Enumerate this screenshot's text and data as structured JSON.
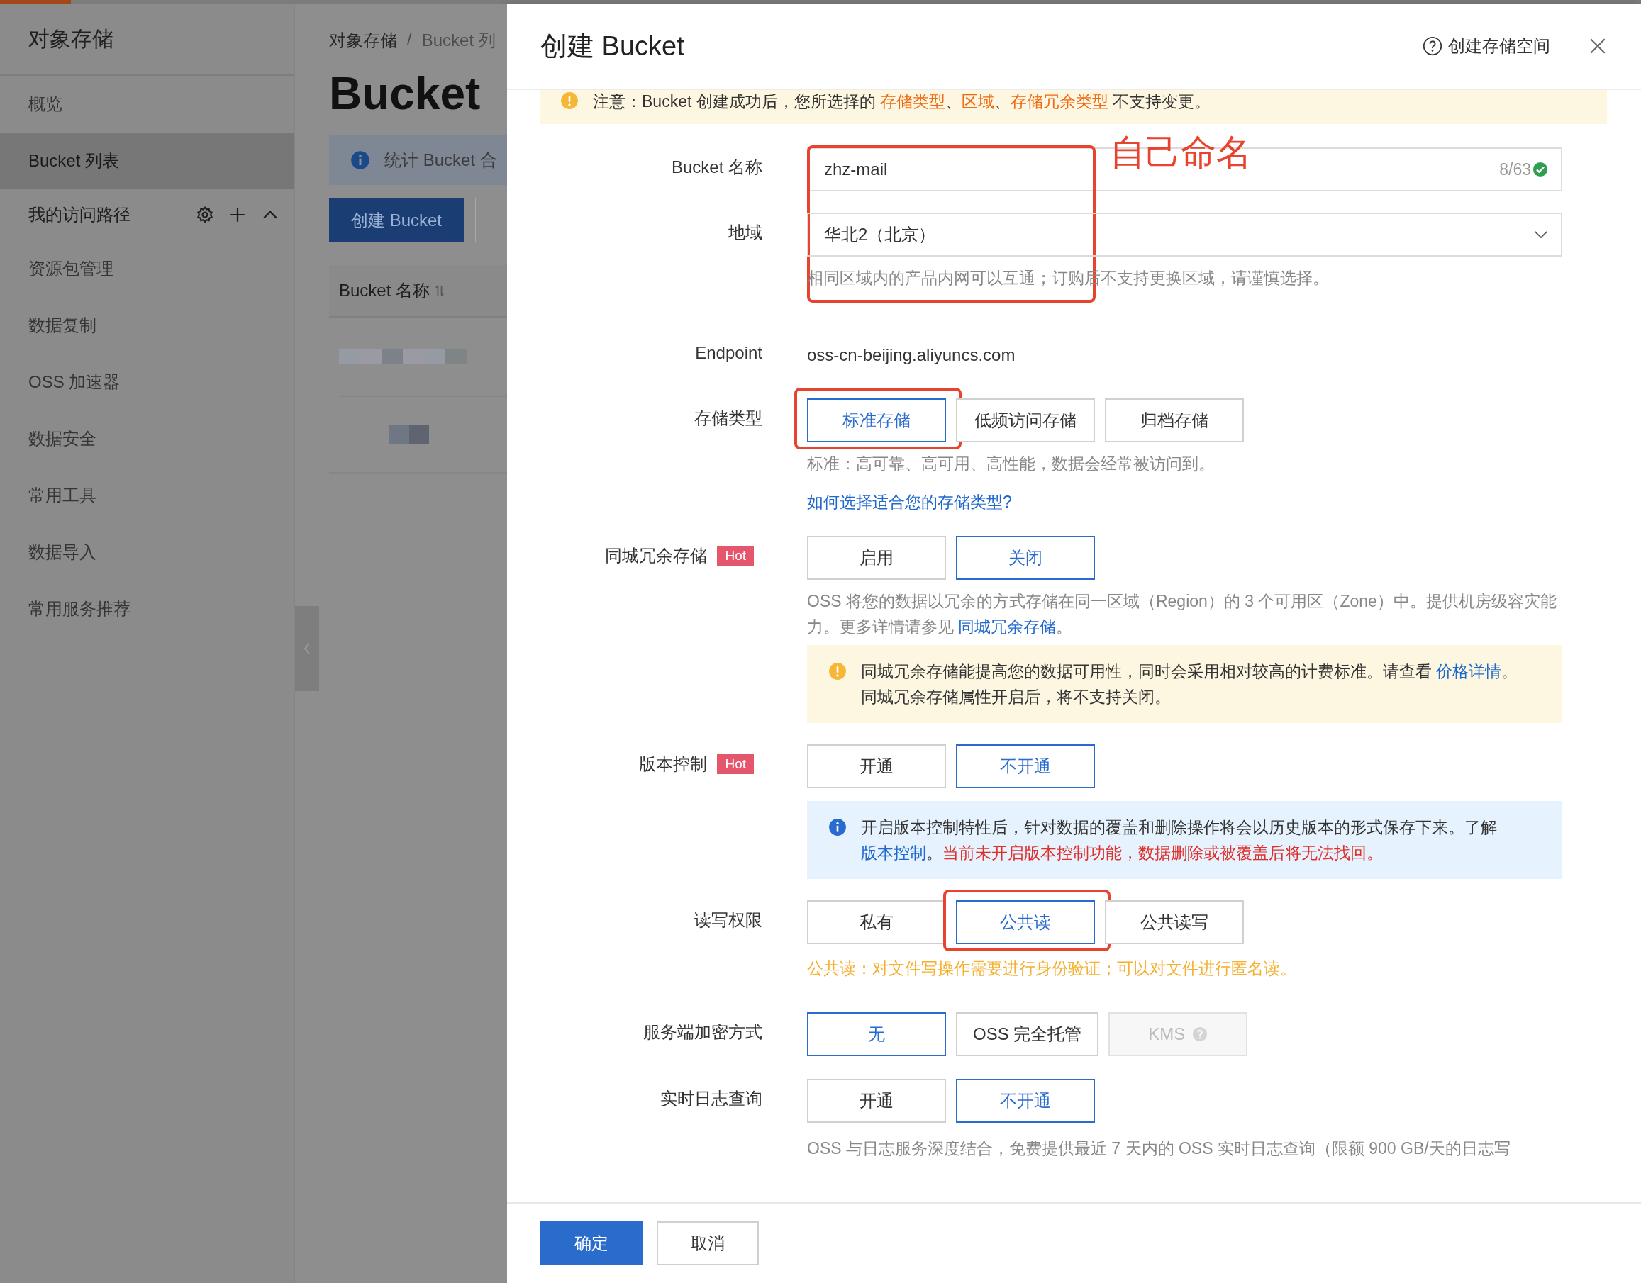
{
  "sidebar": {
    "title": "对象存储",
    "items": [
      {
        "label": "概览",
        "kind": "link",
        "selected": false
      },
      {
        "label": "Bucket 列表",
        "kind": "link",
        "selected": true
      },
      {
        "label": "我的访问路径",
        "kind": "group",
        "expanded": true
      },
      {
        "label": "资源包管理",
        "kind": "link",
        "selected": false
      },
      {
        "label": "数据复制",
        "kind": "link",
        "selected": false
      },
      {
        "label": "OSS 加速器",
        "kind": "link",
        "selected": false
      },
      {
        "label": "数据安全",
        "kind": "link",
        "selected": false
      },
      {
        "label": "常用工具",
        "kind": "link",
        "selected": false
      },
      {
        "label": "数据导入",
        "kind": "link",
        "selected": false
      },
      {
        "label": "常用服务推荐",
        "kind": "link",
        "selected": false
      }
    ]
  },
  "background_page": {
    "breadcrumb": [
      "对象存储",
      "Bucket 列"
    ],
    "breadcrumb_separator": "/",
    "heading": "Bucket",
    "info": "统计 Bucket 合",
    "primary_button": "创建 Bucket",
    "table": {
      "columns": [
        "Bucket 名称"
      ]
    }
  },
  "dialog": {
    "title": "创建 Bucket",
    "help": "创建存储空间",
    "notice": [
      {
        "kind": "plain",
        "text": "注意：Bucket 创建成功后，您所选择的 "
      },
      {
        "kind": "accent",
        "text": "存储类型"
      },
      {
        "kind": "plain",
        "text": "、"
      },
      {
        "kind": "accent",
        "text": "区域"
      },
      {
        "kind": "plain",
        "text": "、"
      },
      {
        "kind": "accent",
        "text": "存储冗余类型"
      },
      {
        "kind": "plain",
        "text": " 不支持变更。"
      }
    ],
    "annotation": {
      "text": "自己命名"
    },
    "fields": [
      {
        "kind": "input",
        "label": "Bucket 名称",
        "value": "zhz-mail",
        "counter": "8/63",
        "valid": true,
        "highlighted": true
      },
      {
        "kind": "select",
        "label": "地域",
        "value": "华北2（北京）",
        "hint": "相同区域内的产品内网可以互通；订购后不支持更换区域，请谨慎选择。",
        "highlighted": true
      },
      {
        "kind": "text",
        "label": "Endpoint",
        "value": "oss-cn-beijing.aliyuncs.com"
      },
      {
        "kind": "options",
        "label": "存储类型",
        "options": [
          {
            "label": "标准存储",
            "selected": true,
            "highlighted": true,
            "disabled": false
          },
          {
            "label": "低频访问存储",
            "selected": false,
            "highlighted": false,
            "disabled": false
          },
          {
            "label": "归档存储",
            "selected": false,
            "highlighted": false,
            "disabled": false
          }
        ],
        "hint": "标准：高可靠、高可用、高性能，数据会经常被访问到。",
        "hint_warning": false,
        "link": "如何选择适合您的存储类型?"
      },
      {
        "kind": "options",
        "label": "同城冗余存储",
        "badge": "Hot",
        "options": [
          {
            "label": "启用",
            "selected": false,
            "highlighted": false,
            "disabled": false
          },
          {
            "label": "关闭",
            "selected": true,
            "highlighted": false,
            "disabled": false
          }
        ],
        "description": [
          {
            "kind": "plain",
            "text": "OSS 将您的数据以冗余的方式存储在同一区域（Region）的 3 个可用区（Zone）中。提供机房级容灾能力。更多详情请参见 "
          },
          {
            "kind": "link",
            "text": "同城冗余存储"
          },
          {
            "kind": "plain",
            "text": "。"
          }
        ],
        "alert": {
          "kind": "warning",
          "segments": [
            {
              "kind": "plain",
              "text": "同城冗余存储能提高您的数据可用性，同时会采用相对较高的计费标准。请查看 "
            },
            {
              "kind": "link",
              "text": "价格详情"
            },
            {
              "kind": "plain",
              "text": "。同城冗余存储属性开启后，将不支持关闭。"
            }
          ]
        }
      },
      {
        "kind": "options",
        "label": "版本控制",
        "badge": "Hot",
        "options": [
          {
            "label": "开通",
            "selected": false,
            "highlighted": false,
            "disabled": false
          },
          {
            "label": "不开通",
            "selected": true,
            "highlighted": false,
            "disabled": false
          }
        ],
        "alert": {
          "kind": "info",
          "segments": [
            {
              "kind": "plain",
              "text": "开启版本控制特性后，针对数据的覆盖和删除操作将会以历史版本的形式保存下来。了解 "
            },
            {
              "kind": "link",
              "text": "版本控制"
            },
            {
              "kind": "plain",
              "text": "。"
            },
            {
              "kind": "danger",
              "text": "当前未开启版本控制功能，数据删除或被覆盖后将无法找回。"
            }
          ]
        }
      },
      {
        "kind": "options",
        "label": "读写权限",
        "options": [
          {
            "label": "私有",
            "selected": false,
            "highlighted": false,
            "disabled": false
          },
          {
            "label": "公共读",
            "selected": true,
            "highlighted": true,
            "disabled": false
          },
          {
            "label": "公共读写",
            "selected": false,
            "highlighted": false,
            "disabled": false
          }
        ],
        "hint": "公共读：对文件写操作需要进行身份验证；可以对文件进行匿名读。",
        "hint_warning": true
      },
      {
        "kind": "options",
        "label": "服务端加密方式",
        "options": [
          {
            "label": "无",
            "selected": true,
            "highlighted": false,
            "disabled": false
          },
          {
            "label": "OSS 完全托管",
            "selected": false,
            "highlighted": false,
            "disabled": false
          },
          {
            "label": "KMS",
            "selected": false,
            "highlighted": false,
            "disabled": true
          }
        ]
      },
      {
        "kind": "options",
        "label": "实时日志查询",
        "options": [
          {
            "label": "开通",
            "selected": false,
            "highlighted": false,
            "disabled": false
          },
          {
            "label": "不开通",
            "selected": true,
            "highlighted": false,
            "disabled": false
          }
        ],
        "hint": "OSS 与日志服务深度结合，免费提供最近 7 天内的 OSS 实时日志查询（限额 900 GB/天的日志写",
        "hint_warning": false
      }
    ],
    "buttons": [
      {
        "label": "确定",
        "kind": "primary"
      },
      {
        "label": "取消",
        "kind": "secondary"
      }
    ]
  }
}
